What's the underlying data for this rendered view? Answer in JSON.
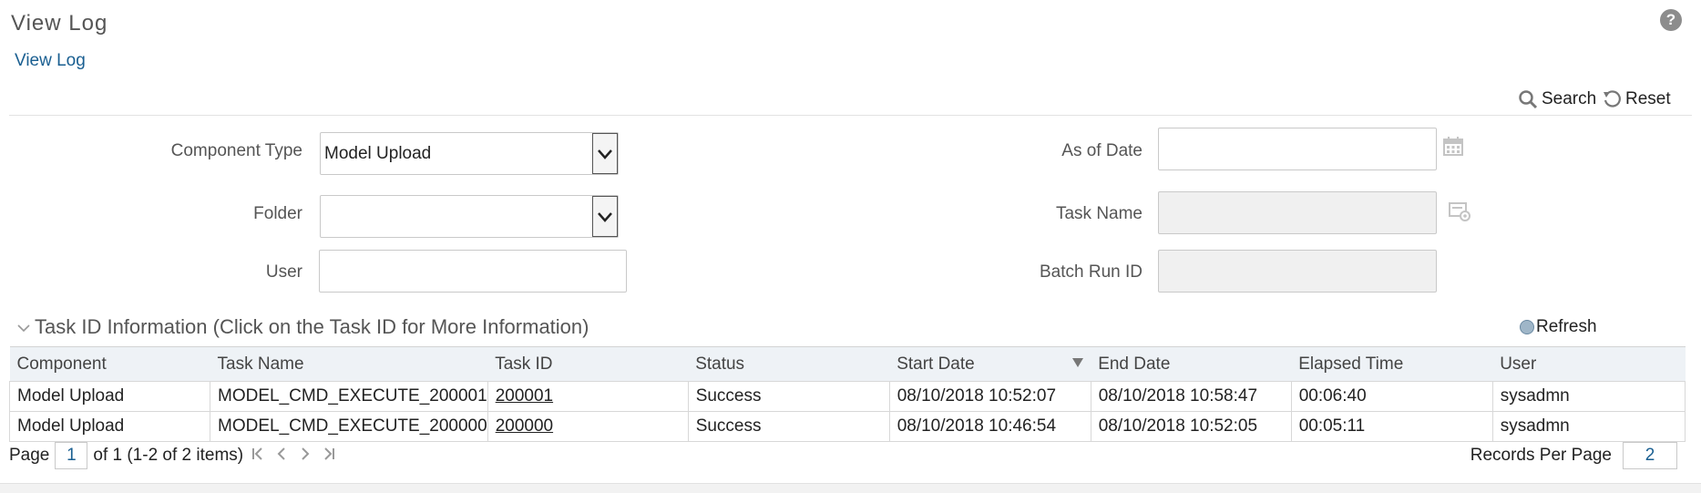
{
  "page": {
    "title": "View Log",
    "help_glyph": "?"
  },
  "subnav": {
    "link_label": "View Log"
  },
  "toolbar": {
    "search_label": "Search",
    "reset_label": "Reset"
  },
  "form": {
    "component_type": {
      "label": "Component Type",
      "value": "Model Upload"
    },
    "folder": {
      "label": "Folder",
      "value": ""
    },
    "user": {
      "label": "User",
      "value": ""
    },
    "as_of_date": {
      "label": "As of Date",
      "value": ""
    },
    "task_name": {
      "label": "Task Name",
      "value": ""
    },
    "batch_run_id": {
      "label": "Batch Run ID",
      "value": ""
    }
  },
  "section": {
    "title": "Task ID Information (Click on the Task ID for More Information)",
    "refresh_label": "Refresh"
  },
  "table": {
    "columns": [
      "Component",
      "Task Name",
      "Task ID",
      "Status",
      "Start Date",
      "End Date",
      "Elapsed Time",
      "User"
    ],
    "rows": [
      [
        "Model Upload",
        "MODEL_CMD_EXECUTE_200001",
        "200001",
        "Success",
        "08/10/2018 10:52:07",
        "08/10/2018 10:58:47",
        "00:06:40",
        "sysadmn"
      ],
      [
        "Model Upload",
        "MODEL_CMD_EXECUTE_200000",
        "200000",
        "Success",
        "08/10/2018 10:46:54",
        "08/10/2018 10:52:05",
        "00:05:11",
        "sysadmn"
      ]
    ]
  },
  "pager": {
    "page_label": "Page",
    "current_page": "1",
    "summary": "of 1 (1-2 of 2 items)",
    "records_label": "Records Per Page",
    "records_value": "2"
  },
  "icons": {
    "search": "search-icon",
    "reset": "reset-icon",
    "calendar": "calendar-icon",
    "task_picker": "task-picker-icon",
    "collapse": "chevron-down-icon",
    "refresh": "refresh-icon",
    "sort": "sort-desc-icon"
  },
  "colors": {
    "link": "#1a5f91",
    "header_bg": "#eef2f6",
    "disabled_bg": "#f0f0f0"
  }
}
